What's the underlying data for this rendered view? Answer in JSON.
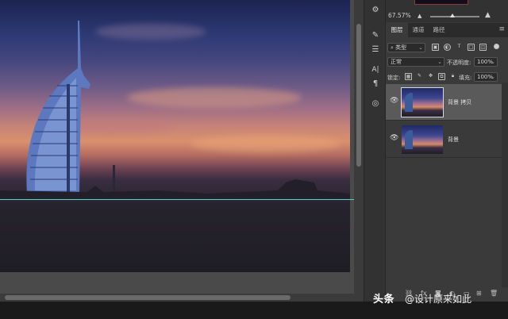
{
  "navigator": {
    "zoom": "67.57%",
    "zoom_out_icon": "mountain-small-icon",
    "zoom_in_icon": "mountain-large-icon",
    "slider_level_fraction": 0.45
  },
  "tabs": [
    {
      "label": "图层",
      "active": true
    },
    {
      "label": "通道",
      "active": false
    },
    {
      "label": "路径",
      "active": false
    }
  ],
  "layers_panel": {
    "filter_kind": "类型",
    "blend_mode": "正常",
    "opacity_label": "不透明度:",
    "opacity_value": "100%",
    "lock_label": "锁定:",
    "fill_label": "填充:",
    "fill_value": "100%",
    "layers": [
      {
        "name": "背景 拷贝",
        "visible": true,
        "selected": true
      },
      {
        "name": "背景",
        "visible": true,
        "selected": false
      }
    ]
  },
  "watermark": {
    "brand": "头条",
    "handle": "@设计原来如此"
  },
  "colors": {
    "guide": "#58d3c6",
    "panel_bg": "#3a3a3a",
    "selected_layer": "#5a5a5a"
  }
}
